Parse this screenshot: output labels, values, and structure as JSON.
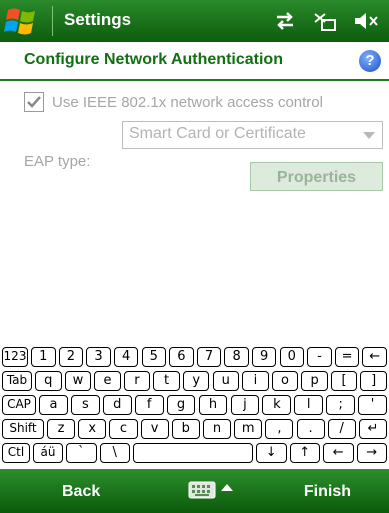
{
  "titlebar": {
    "title": "Settings",
    "icons": [
      "start-flag-icon",
      "connectivity-icon",
      "signal-off-icon",
      "volume-off-icon"
    ]
  },
  "header": {
    "title": "Configure Network Authentication",
    "help_icon": "help-icon",
    "help_glyph": "?"
  },
  "form": {
    "use_8021x_label": "Use IEEE 802.1x network access control",
    "use_8021x_checked": true,
    "eap_label": "EAP type:",
    "eap_value": "Smart Card or Certificate",
    "properties_label": "Properties"
  },
  "keyboard": {
    "rows": [
      [
        "123",
        "1",
        "2",
        "3",
        "4",
        "5",
        "6",
        "7",
        "8",
        "9",
        "0",
        "-",
        "=",
        "←"
      ],
      [
        "Tab",
        "q",
        "w",
        "e",
        "r",
        "t",
        "y",
        "u",
        "i",
        "o",
        "p",
        "[",
        "]"
      ],
      [
        "CAP",
        "a",
        "s",
        "d",
        "f",
        "g",
        "h",
        "j",
        "k",
        "l",
        ";",
        "'"
      ],
      [
        "Shift",
        "z",
        "x",
        "c",
        "v",
        "b",
        "n",
        "m",
        ",",
        ".",
        "/",
        "↵"
      ],
      [
        "Ctl",
        "áü",
        "`",
        "\\",
        " ",
        "↓",
        "↑",
        "←",
        "→"
      ]
    ]
  },
  "bottombar": {
    "left_soft_key": "Back",
    "right_soft_key": "Finish",
    "sip_icon": "keyboard-icon"
  }
}
